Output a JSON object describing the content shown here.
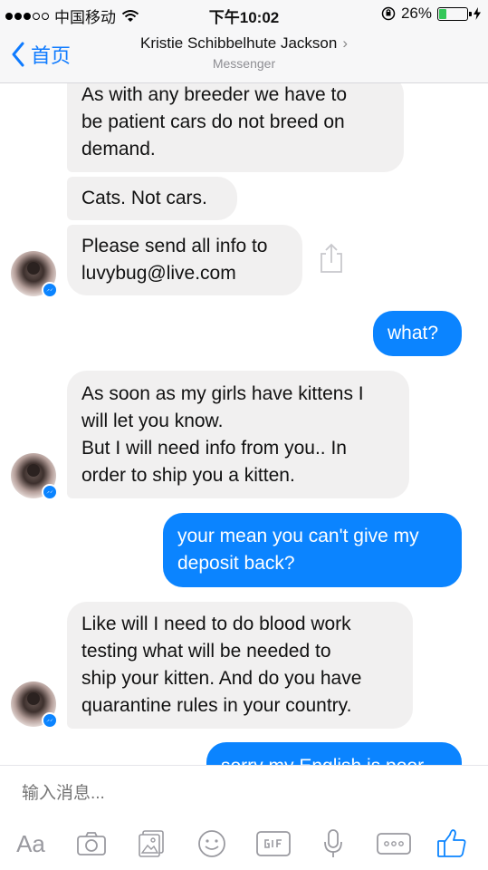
{
  "status_bar": {
    "carrier": "中国移动",
    "time": "下午10:02",
    "battery_percent_text": "26%",
    "battery_level": 0.26
  },
  "header": {
    "back_label": "首页",
    "contact_name": "Kristie Schibbelhute Jackson",
    "subtitle": "Messenger"
  },
  "messages": [
    {
      "direction": "incoming",
      "text": "As with any breeder we have to\nbe patient cars do not breed on\ndemand."
    },
    {
      "direction": "incoming",
      "text": "Cats. Not cars."
    },
    {
      "direction": "incoming",
      "text": "Please send all info to\nluvybug@live.com"
    },
    {
      "direction": "outgoing",
      "text": "what?"
    },
    {
      "direction": "incoming",
      "text": "As soon as my girls have kittens I\nwill let you know.\nBut I will need info from you.. In\norder to ship you a kitten."
    },
    {
      "direction": "outgoing",
      "text": "your mean you can't give my\ndeposit back?"
    },
    {
      "direction": "incoming",
      "text": "Like will I need to do blood work\ntesting what will be needed to\nship your kitten. And do you have\nquarantine rules in your country."
    },
    {
      "direction": "outgoing",
      "text": "sorry my English is poor"
    }
  ],
  "composer": {
    "placeholder": "输入消息...",
    "aa_label": "Aa"
  },
  "colors": {
    "accent": "#0b84ff",
    "incoming_bubble": "#f1f0f0",
    "toolbar_icon": "#9a9aa0"
  },
  "icons": [
    "camera-icon",
    "photo-icon",
    "sticker-icon",
    "gif-icon",
    "microphone-icon",
    "more-icon",
    "thumbs-up-icon"
  ]
}
